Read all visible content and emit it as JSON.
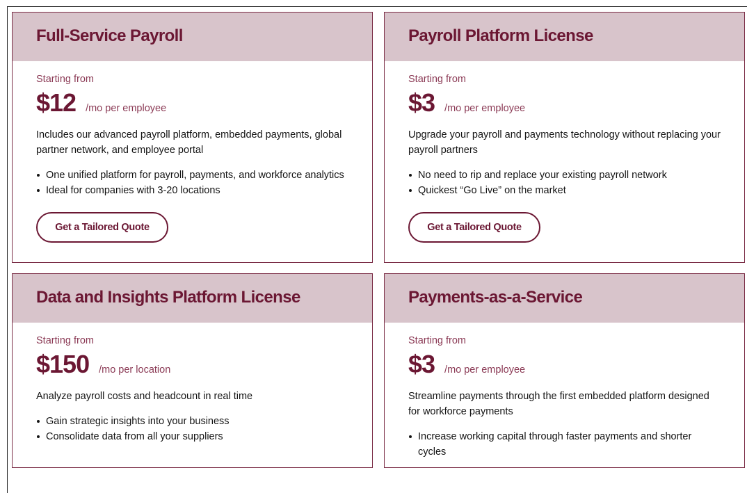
{
  "cards": [
    {
      "title": "Full-Service Payroll",
      "starting": "Starting from",
      "price": "$12",
      "unit": "/mo per employee",
      "description": "Includes our advanced payroll platform, embedded payments, global partner network, and employee portal",
      "bullets": [
        "One unified platform for payroll, payments, and workforce analytics",
        "Ideal for companies with 3-20 locations"
      ],
      "button": "Get a Tailored Quote"
    },
    {
      "title": "Payroll Platform License",
      "starting": "Starting from",
      "price": "$3",
      "unit": "/mo per employee",
      "description": "Upgrade your payroll and payments technology without replacing your payroll partners",
      "bullets": [
        "No need to rip and replace your existing payroll network",
        "Quickest “Go Live” on the market"
      ],
      "button": "Get a Tailored Quote"
    },
    {
      "title": "Data and Insights Platform License",
      "starting": "Starting from",
      "price": "$150",
      "unit": "/mo per location",
      "description": "Analyze payroll costs and headcount in real time",
      "bullets": [
        "Gain strategic insights into your business",
        "Consolidate data from all your suppliers"
      ]
    },
    {
      "title": "Payments-as-a-Service",
      "starting": "Starting from",
      "price": "$3",
      "unit": "/mo per employee",
      "description": "Streamline payments through the first embedded platform designed for workforce payments",
      "bullets": [
        "Increase working capital through faster payments and shorter cycles"
      ]
    }
  ],
  "colors": {
    "accent": "#6b1733",
    "header_bg": "#d8c4cb",
    "muted": "#8b3a55",
    "border": "#7a2c45"
  }
}
